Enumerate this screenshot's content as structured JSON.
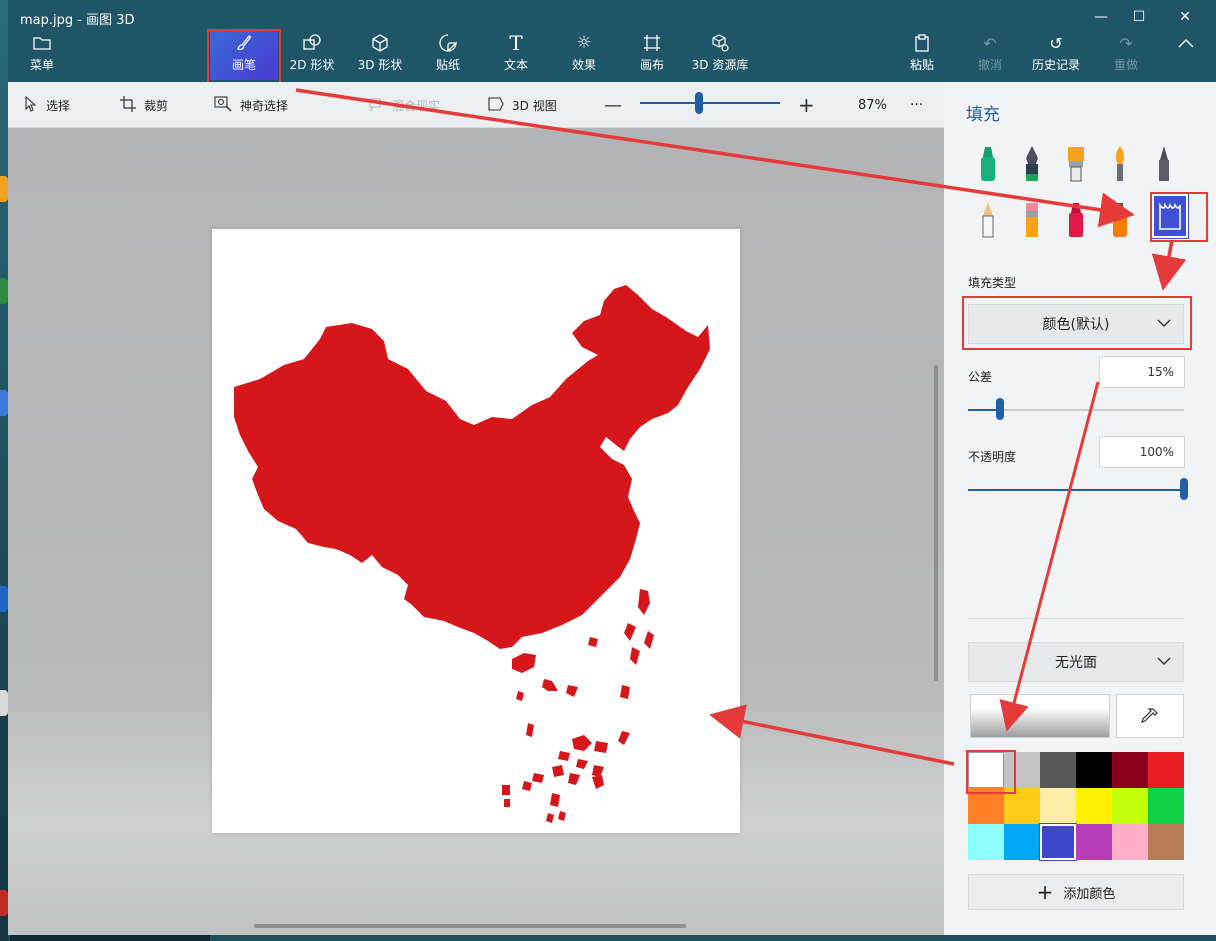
{
  "window": {
    "title": "map.jpg - 画图 3D",
    "minimize_icon": "minimize-icon",
    "maximize_icon": "maximize-icon",
    "close_icon": "close-icon"
  },
  "ribbon": {
    "menu_label": "菜单",
    "tools": [
      {
        "label": "画笔",
        "icon": "brush-icon",
        "active": true
      },
      {
        "label": "2D 形状",
        "icon": "2d-shapes-icon"
      },
      {
        "label": "3D 形状",
        "icon": "3d-shapes-icon"
      },
      {
        "label": "贴纸",
        "icon": "sticker-icon"
      },
      {
        "label": "文本",
        "icon": "text-icon"
      },
      {
        "label": "效果",
        "icon": "effects-icon"
      },
      {
        "label": "画布",
        "icon": "canvas-icon"
      },
      {
        "label": "3D 资源库",
        "icon": "3d-library-icon"
      }
    ],
    "right_tools": [
      {
        "label": "粘贴",
        "icon": "paste-icon",
        "enabled": true
      },
      {
        "label": "撤消",
        "icon": "undo-icon",
        "enabled": false
      },
      {
        "label": "历史记录",
        "icon": "history-icon",
        "enabled": true
      },
      {
        "label": "重做",
        "icon": "redo-icon",
        "enabled": false
      }
    ],
    "collapse_icon": "chevron-up-icon"
  },
  "subbar": {
    "select_label": "选择",
    "crop_label": "裁剪",
    "magic_select_label": "神奇选择",
    "mixed_reality_label": "混合现实",
    "view3d_label": "3D 视图",
    "zoom_value": "87%",
    "zoom_fraction": 0.42,
    "more_label": "···"
  },
  "panel": {
    "title": "填充",
    "brushes": [
      "marker",
      "calligraphy-pen",
      "oil-brush",
      "watercolor",
      "pixel-pen",
      "pencil",
      "eraser",
      "crayon",
      "spray-can",
      "fill"
    ],
    "selected_brush": "fill",
    "fill_type_label": "填充类型",
    "fill_type_value": "颜色(默认)",
    "tolerance_label": "公差",
    "tolerance_value": "15%",
    "tolerance_fraction": 0.15,
    "opacity_label": "不透明度",
    "opacity_value": "100%",
    "opacity_fraction": 1.0,
    "finish_value": "无光面",
    "add_color_label": "添加颜色",
    "selected_color": "#ffffff",
    "palette": [
      "#ffffff",
      "#c3c3c3",
      "#585858",
      "#000000",
      "#88001b",
      "#ec1c24",
      "#ff7f27",
      "#ffca18",
      "#fdeca6",
      "#fff200",
      "#c4ff0e",
      "#0ed145",
      "#8cfffb",
      "#00a8f3",
      "#3f48cc",
      "#b83dba",
      "#ffaec8",
      "#b97a56"
    ]
  },
  "colors": {
    "ribbon": "#1e5567",
    "accent": "#1f5fa6",
    "highlight": "#e53a3a",
    "map_fill": "#d5161b"
  }
}
